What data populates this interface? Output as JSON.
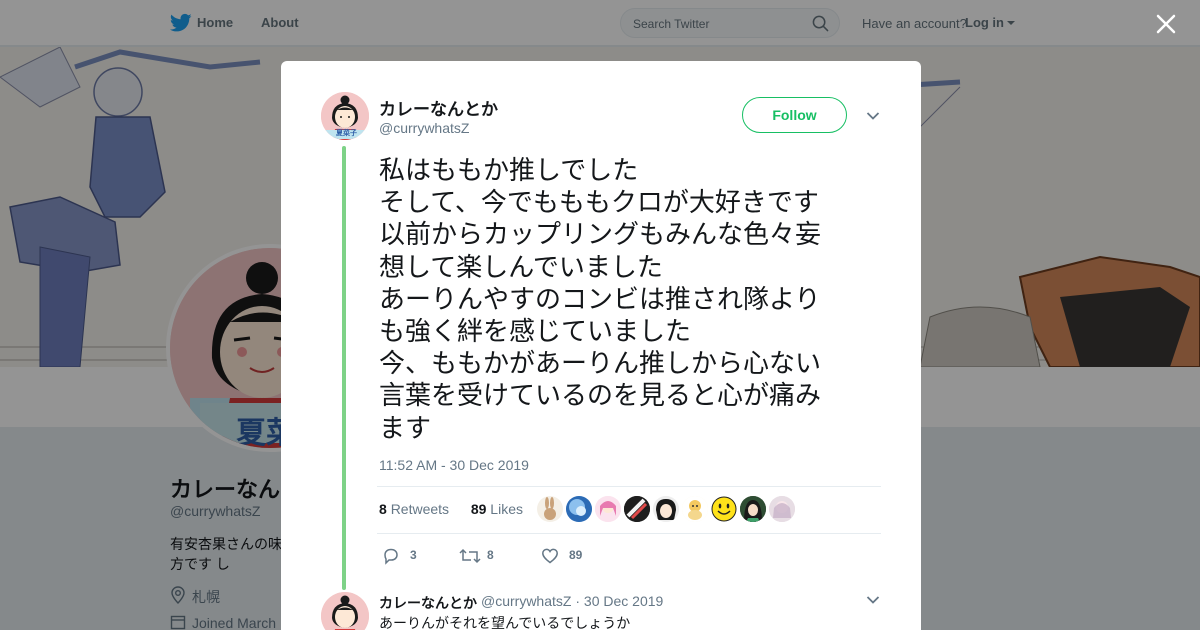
{
  "nav": {
    "home_label": "Home",
    "about_label": "About",
    "search_placeholder": "Search Twitter",
    "have_account": "Have an account?",
    "login_label": "Log in"
  },
  "profile": {
    "name": "カレーなんとか",
    "handle": "@currywhatsZ",
    "bio": "有安杏果さんの味方です し",
    "location": "札幌",
    "joined": "Joined March",
    "avatar_caption": "夏菜"
  },
  "tweet": {
    "name": "カレーなんとか",
    "handle": "@currywhatsZ",
    "avatar_caption": "夏菜子",
    "follow_label": "Follow",
    "text_lines": [
      "私はももか推しでした",
      "そして、今でもももクロが大好きです",
      "以前からカップリングもみんな色々妄",
      "想して楽しんでいました",
      "あーりんやすのコンビは推され隊より",
      "も強く絆を感じていました",
      "今、ももかがあーりん推しから心ない",
      "言葉を受けているのを見ると心が痛み",
      "ます"
    ],
    "timestamp": "11:52 AM - 30 Dec 2019",
    "retweets_count": "8",
    "retweets_label": "Retweets",
    "likes_count": "89",
    "likes_label": "Likes",
    "replies_action_count": "3",
    "retweets_action_count": "8",
    "likes_action_count": "89"
  },
  "reply": {
    "name": "カレーなんとか",
    "handle": "@currywhatsZ",
    "separator": "·",
    "date": "30 Dec 2019",
    "text": "あーりんがそれを望んでいるでしょうか"
  },
  "colors": {
    "twitter_blue": "#1da1f2",
    "follow_green": "#17bf63",
    "thread_line": "#7ed287"
  },
  "icons": [
    "twitter-bird-icon",
    "search-icon",
    "close-icon",
    "chevron-down-icon",
    "reply-icon",
    "retweet-icon",
    "heart-icon",
    "location-icon",
    "calendar-icon"
  ]
}
